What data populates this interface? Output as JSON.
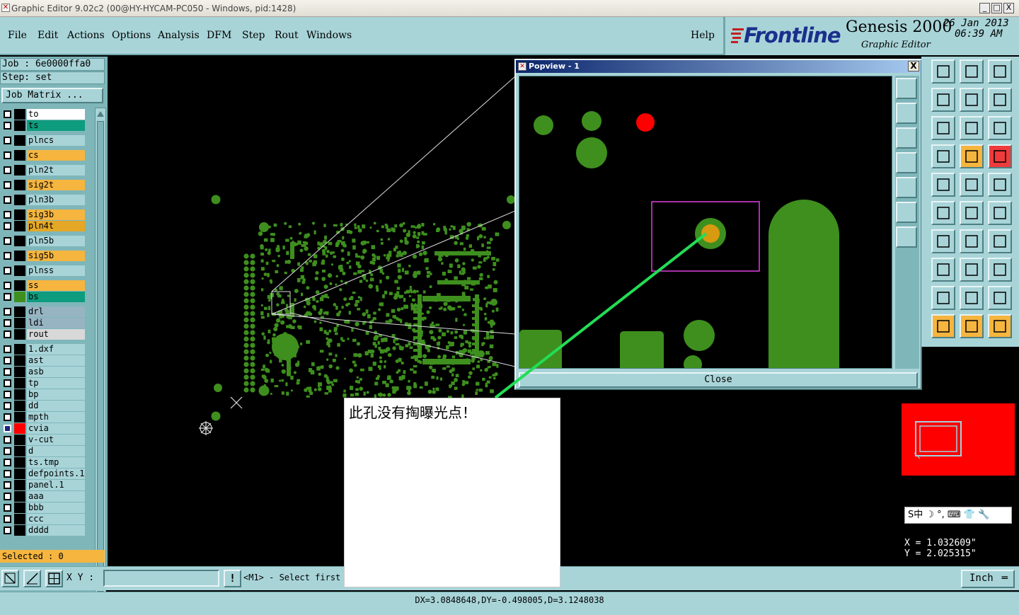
{
  "window": {
    "title": "Graphic Editor 9.02c2 (00@HY-HYCAM-PC050 - Windows, pid:1428)",
    "min_glyph": "_",
    "max_glyph": "□",
    "close_glyph": "X"
  },
  "menubar": {
    "items": [
      "File",
      "Edit",
      "Actions",
      "Options",
      "Analysis",
      "DFM",
      "Step",
      "Rout",
      "Windows"
    ],
    "help": "Help"
  },
  "brand": {
    "logo": "Frontline",
    "product": "Genesis 2000",
    "subtitle": "Graphic Editor",
    "date_line1": "26 Jan 2013",
    "date_line2": "06:39 AM"
  },
  "job": {
    "job_label": "Job : 6e0000ffa0",
    "step_label": "Step: set",
    "matrix_button": "Job Matrix ..."
  },
  "layers": [
    {
      "name": "to",
      "color": "#ffffff",
      "swatch": "#000000",
      "checked": false
    },
    {
      "name": "ts",
      "color": "#0e9c7e",
      "swatch": "#000000",
      "checked": false
    },
    {
      "name": "plncs",
      "color": "#a8d4d8",
      "swatch": "#000000",
      "checked": false
    },
    {
      "name": "cs",
      "color": "#f5b53f",
      "swatch": "#000000",
      "checked": false
    },
    {
      "name": "pln2t",
      "color": "#a8d4d8",
      "swatch": "#000000",
      "checked": false
    },
    {
      "name": "sig2t",
      "color": "#f5b53f",
      "swatch": "#000000",
      "checked": false
    },
    {
      "name": "pln3b",
      "color": "#a8d4d8",
      "swatch": "#000000",
      "checked": false
    },
    {
      "name": "sig3b",
      "color": "#f5b53f",
      "swatch": "#000000",
      "checked": false
    },
    {
      "name": "pln4t",
      "color": "#e4a726",
      "swatch": "#000000",
      "checked": false
    },
    {
      "name": "pln5b",
      "color": "#a8d4d8",
      "swatch": "#000000",
      "checked": false
    },
    {
      "name": "sig5b",
      "color": "#f5b53f",
      "swatch": "#000000",
      "checked": false
    },
    {
      "name": "plnss",
      "color": "#a8d4d8",
      "swatch": "#000000",
      "checked": false
    },
    {
      "name": "ss",
      "color": "#f5b53f",
      "swatch": "#000000",
      "checked": false
    },
    {
      "name": "bs",
      "color": "#0e9c7e",
      "swatch": "#3e8f1e",
      "checked": false
    },
    {
      "name": "drl",
      "color": "#97b4c2",
      "swatch": "#000000",
      "checked": false
    },
    {
      "name": "ldi",
      "color": "#97b4c2",
      "swatch": "#000000",
      "checked": false
    },
    {
      "name": "rout",
      "color": "#d8d8d8",
      "swatch": "#000000",
      "checked": false
    },
    {
      "name": "1.dxf",
      "color": "#a8d4d8",
      "swatch": "#000000",
      "checked": false
    },
    {
      "name": "ast",
      "color": "#a8d4d8",
      "swatch": "#000000",
      "checked": false
    },
    {
      "name": "asb",
      "color": "#a8d4d8",
      "swatch": "#000000",
      "checked": false
    },
    {
      "name": "tp",
      "color": "#a8d4d8",
      "swatch": "#000000",
      "checked": false
    },
    {
      "name": "bp",
      "color": "#a8d4d8",
      "swatch": "#000000",
      "checked": false
    },
    {
      "name": "dd",
      "color": "#a8d4d8",
      "swatch": "#000000",
      "checked": false
    },
    {
      "name": "mpth",
      "color": "#a8d4d8",
      "swatch": "#000000",
      "checked": false
    },
    {
      "name": "cvia",
      "color": "#a8d4d8",
      "swatch": "#ff0000",
      "checked": true
    },
    {
      "name": "v-cut",
      "color": "#a8d4d8",
      "swatch": "#000000",
      "checked": false
    },
    {
      "name": "d",
      "color": "#a8d4d8",
      "swatch": "#000000",
      "checked": false
    },
    {
      "name": "ts.tmp",
      "color": "#a8d4d8",
      "swatch": "#000000",
      "checked": false
    },
    {
      "name": "defpoints.1",
      "color": "#a8d4d8",
      "swatch": "#000000",
      "checked": false
    },
    {
      "name": "panel.1",
      "color": "#a8d4d8",
      "swatch": "#000000",
      "checked": false
    },
    {
      "name": "aaa",
      "color": "#a8d4d8",
      "swatch": "#000000",
      "checked": false
    },
    {
      "name": "bbb",
      "color": "#a8d4d8",
      "swatch": "#000000",
      "checked": false
    },
    {
      "name": "ccc",
      "color": "#a8d4d8",
      "swatch": "#000000",
      "checked": false
    },
    {
      "name": "dddd",
      "color": "#a8d4d8",
      "swatch": "#000000",
      "checked": false
    }
  ],
  "selected_text": "Selected : 0",
  "bottom": {
    "xy_label": "X Y :",
    "xy_value": "",
    "alert_glyph": "!",
    "hint": "<M1> - Select first",
    "units": "Inch"
  },
  "status": "DX=3.0848648,DY=-0.498005,D=3.1248038",
  "coords": {
    "x": "X = 1.032609\"",
    "y": "Y = 2.025315\""
  },
  "popview": {
    "title": "Popview - 1",
    "close_glyph": "X",
    "close_button": "Close"
  },
  "note": {
    "text": "此孔没有掏曝光点！"
  },
  "ime": {
    "text": "S中 ☽ °, ⌨ 👕 🔧"
  },
  "colors": {
    "panel": "#a8d4d8",
    "panel_dark": "#7fb6ba",
    "pad_green": "#3e8f1e",
    "highlight_orange": "#d79a10",
    "pad_red": "#ff0000",
    "selection_box": "#e040e0",
    "leader_line": "#22dd55"
  }
}
